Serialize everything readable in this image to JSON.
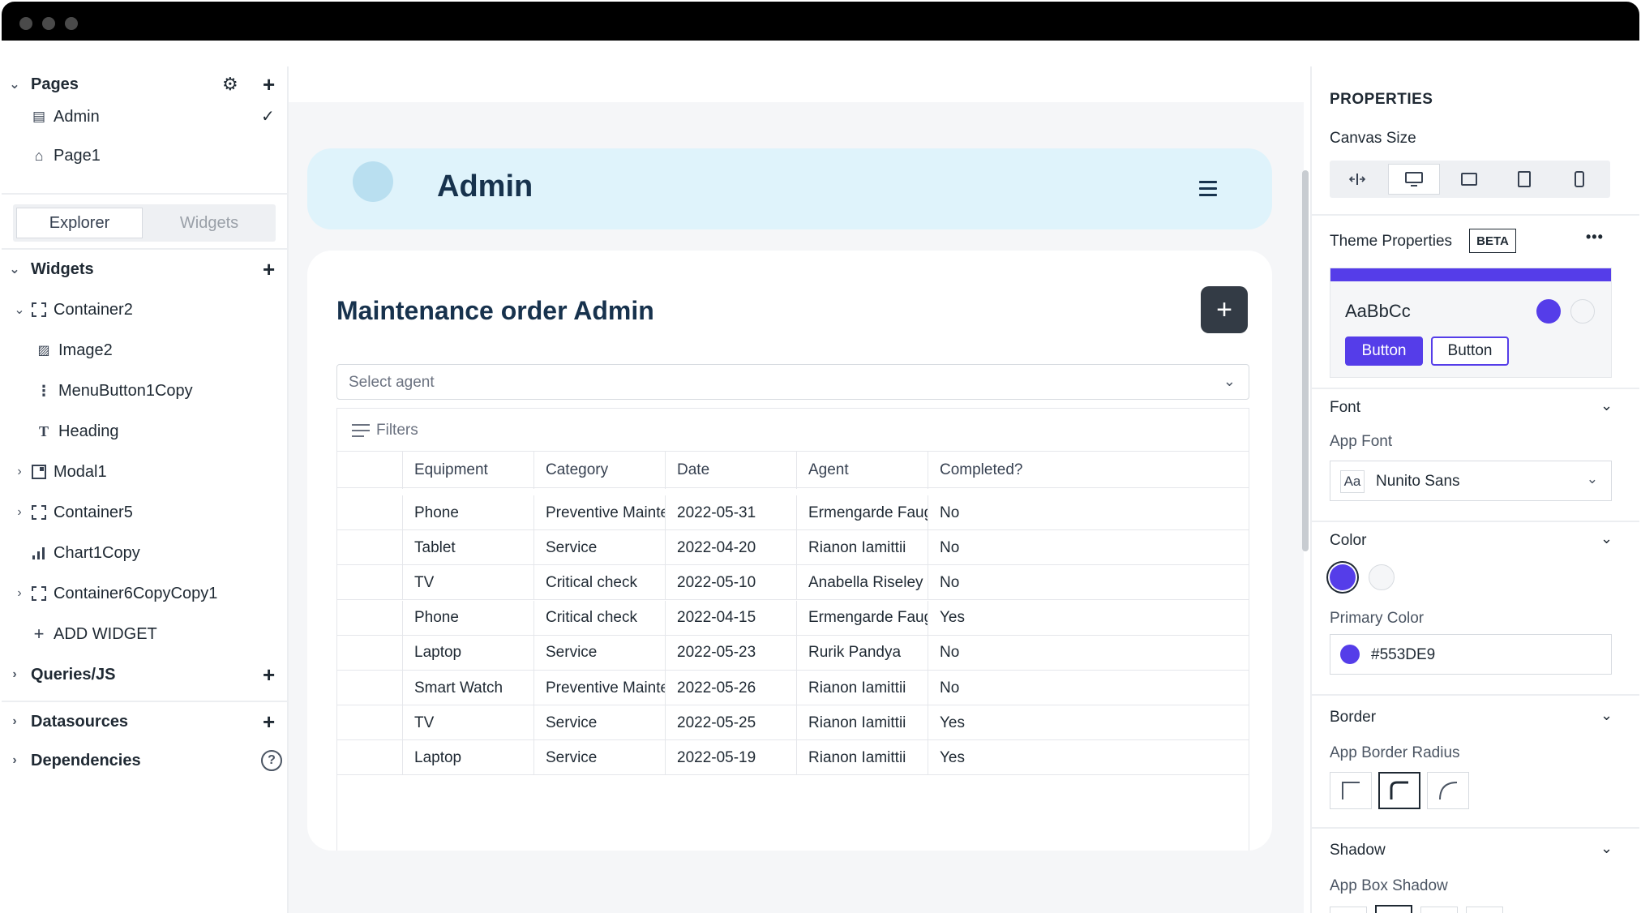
{
  "sidebar": {
    "pages_header": "Pages",
    "pages": [
      {
        "label": "Admin",
        "selected": true
      },
      {
        "label": "Page1",
        "selected": false
      }
    ],
    "tabs": [
      "Explorer",
      "Widgets"
    ],
    "widgets_header": "Widgets",
    "widgets": [
      "Container2",
      "Image2",
      "MenuButton1Copy",
      "Heading",
      "Modal1",
      "Container5",
      "Chart1Copy",
      "Container6CopyCopy1"
    ],
    "add_widget": "ADD WIDGET",
    "queries": "Queries/JS",
    "datasources": "Datasources",
    "dependencies": "Dependencies"
  },
  "canvas": {
    "header_title": "Admin",
    "card_title": "Maintenance order Admin",
    "add_button": "+",
    "select_placeholder": "Select agent",
    "filters_label": "Filters",
    "table": {
      "columns": [
        "Equipment",
        "Category",
        "Date",
        "Agent",
        "Completed?"
      ],
      "rows": [
        [
          "Phone",
          "Preventive Mainte...",
          "2022-05-31",
          "Ermengarde Faug...",
          "No"
        ],
        [
          "Tablet",
          "Service",
          "2022-04-20",
          "Rianon Iamittii",
          "No"
        ],
        [
          "TV",
          "Critical check",
          "2022-05-10",
          "Anabella Riseley",
          "No"
        ],
        [
          "Phone",
          "Critical check",
          "2022-04-15",
          "Ermengarde Faug...",
          "Yes"
        ],
        [
          "Laptop",
          "Service",
          "2022-05-23",
          "Rurik Pandya",
          "No"
        ],
        [
          "Smart Watch",
          "Preventive Mainte...",
          "2022-05-26",
          "Rianon Iamittii",
          "No"
        ],
        [
          "TV",
          "Service",
          "2022-05-25",
          "Rianon Iamittii",
          "Yes"
        ],
        [
          "Laptop",
          "Service",
          "2022-05-19",
          "Rianon Iamittii",
          "Yes"
        ]
      ]
    }
  },
  "properties": {
    "title": "PROPERTIES",
    "canvas_size": "Canvas Size",
    "theme_properties": "Theme Properties",
    "beta": "BETA",
    "more": "•••",
    "theme_sample": "AaBbCc",
    "button_primary": "Button",
    "button_secondary": "Button",
    "font_section": "Font",
    "app_font": "App Font",
    "font_aa": "Aa",
    "font_value": "Nunito Sans",
    "color_section": "Color",
    "primary_color_label": "Primary Color",
    "primary_color_value": "#553DE9",
    "border_section": "Border",
    "border_radius_label": "App Border Radius",
    "shadow_section": "Shadow",
    "box_shadow_label": "App Box Shadow"
  },
  "colors": {
    "primary": "#553de9",
    "header_bg": "#dff3fb",
    "title": "#17324d",
    "add_button_bg": "#333b45"
  }
}
